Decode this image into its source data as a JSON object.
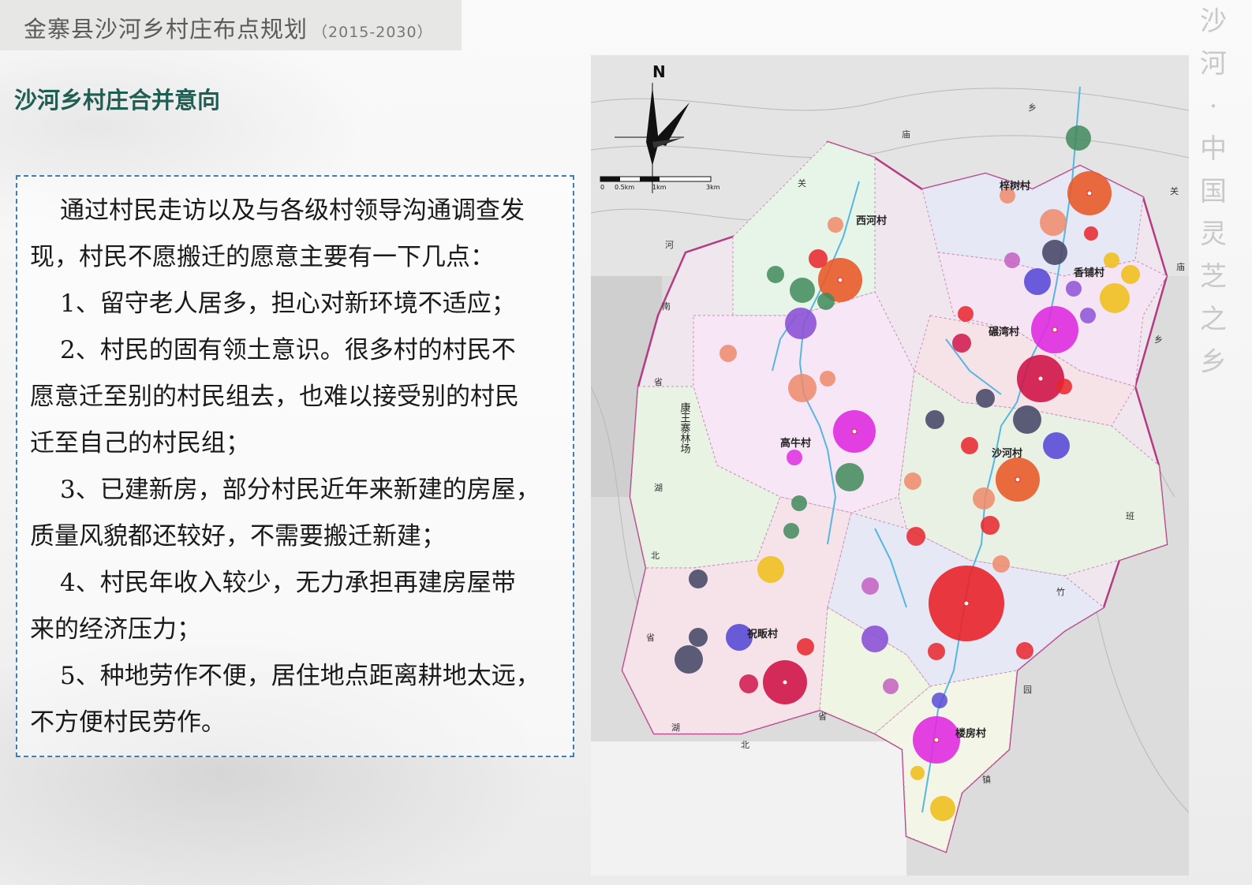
{
  "header": {
    "title": "金寨县沙河乡村庄布点规划",
    "year_range": "（2015-2030）"
  },
  "section": {
    "title": "沙河乡村庄合并意向"
  },
  "body": {
    "lines": [
      "通过村民走访以及与各级村领导沟通调查发",
      "现，村民不愿搬迁的愿意主要有一下几点：",
      "1、留守老人居多，担心对新环境不适应；",
      "2、村民的固有领土意识。很多村的村民不",
      "愿意迁至别的村民组去，也难以接受别的村民",
      "迁至自己的村民组；",
      "3、已建新房，部分村民近年来新建的房屋，",
      "质量风貌都还较好，不需要搬迁新建；",
      "4、村民年收入较少，无力承担再建房屋带",
      "来的经济压力；",
      "5、种地劳作不便，居住地点距离耕地太远，",
      "不方便村民劳作。"
    ]
  },
  "calligraphy": [
    "沙",
    "河",
    "·",
    "中",
    "国",
    "灵",
    "芝",
    "之",
    "乡"
  ],
  "map": {
    "north_label": "N",
    "scale_labels": [
      "0",
      "0.5km",
      "1km",
      "3km"
    ],
    "villages": [
      "西河村",
      "梓树村",
      "香铺村",
      "碾湾村",
      "高牛村",
      "沙河村",
      "祝畈村",
      "楼房村"
    ],
    "forest_farm": "康王寨林场",
    "border_chars": {
      "west": [
        "河",
        "南",
        "省",
        "湖",
        "北",
        "省"
      ],
      "north": [
        "关",
        "庙",
        "乡"
      ],
      "east": [
        "关",
        "庙",
        "乡"
      ],
      "southeast": [
        "班",
        "竹",
        "园",
        "镇"
      ],
      "south": [
        "湖",
        "北",
        "省"
      ]
    },
    "legend_colors": {
      "red": "#e8242b",
      "orange": "#e85b2a",
      "crimson": "#d0154a",
      "magenta": "#e02ce0",
      "violet": "#8c52d6",
      "blue_violet": "#5a4bd6",
      "slate": "#4a4a6a",
      "green": "#3f8a5a",
      "salmon": "#ef8a6a",
      "gold": "#f0c020"
    }
  }
}
